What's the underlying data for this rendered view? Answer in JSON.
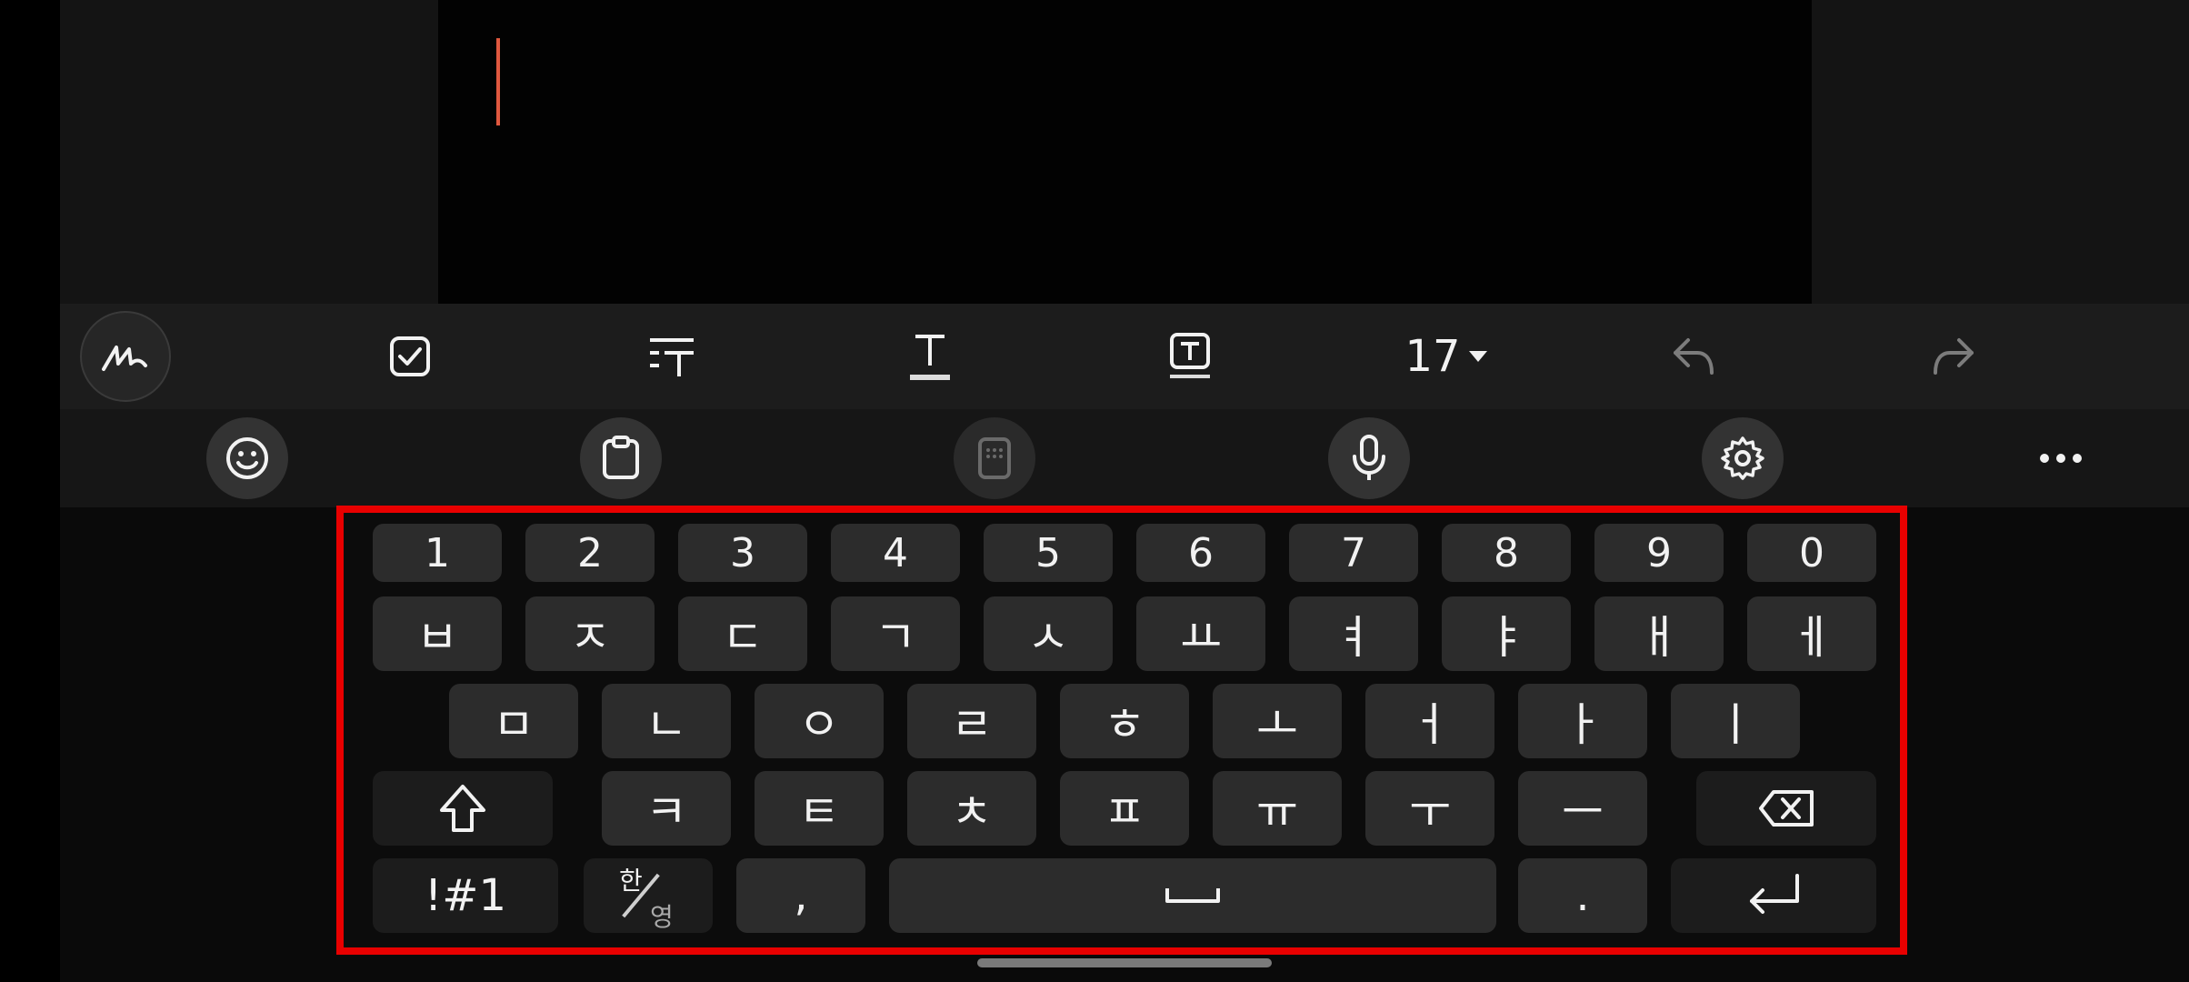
{
  "toolbar": {
    "font_size": "17"
  },
  "keyboard": {
    "row_numbers": [
      "1",
      "2",
      "3",
      "4",
      "5",
      "6",
      "7",
      "8",
      "9",
      "0"
    ],
    "row1": [
      "ㅂ",
      "ㅈ",
      "ㄷ",
      "ㄱ",
      "ㅅ",
      "ㅛ",
      "ㅕ",
      "ㅑ",
      "ㅐ",
      "ㅔ"
    ],
    "row2": [
      "ㅁ",
      "ㄴ",
      "ㅇ",
      "ㄹ",
      "ㅎ",
      "ㅗ",
      "ㅓ",
      "ㅏ",
      "ㅣ"
    ],
    "row3": [
      "ㅋ",
      "ㅌ",
      "ㅊ",
      "ㅍ",
      "ㅠ",
      "ㅜ",
      "ㅡ"
    ],
    "symbols_label": "!#1",
    "lang_han": "한",
    "lang_eng": "영",
    "comma": ",",
    "period": "."
  }
}
